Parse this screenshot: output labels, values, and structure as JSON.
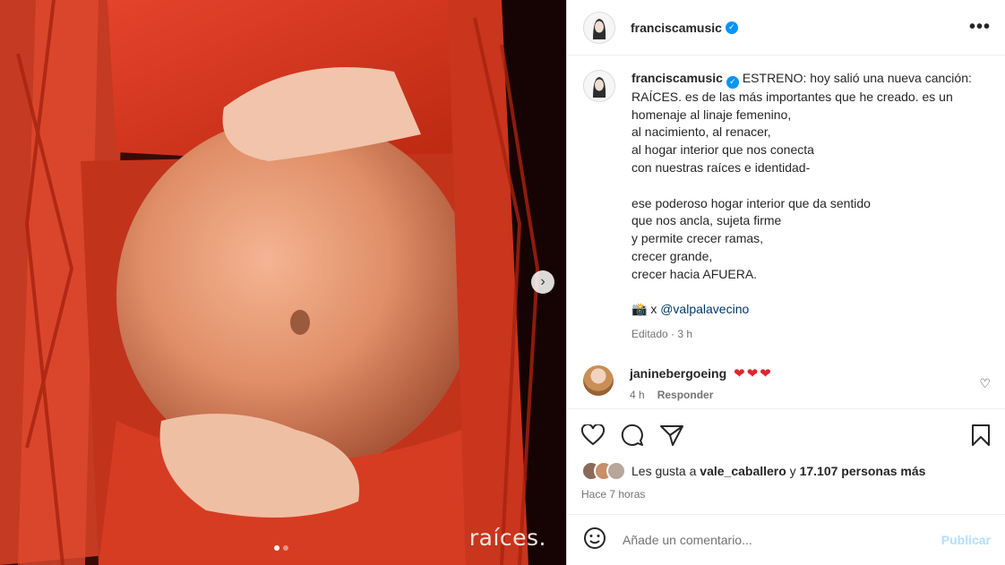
{
  "media": {
    "overlay_text": "raíces.",
    "slide_count": 2,
    "current_slide": 1,
    "next_glyph": "›"
  },
  "header": {
    "username": "franciscamusic",
    "verified_glyph": "✓",
    "more_glyph": "•••"
  },
  "post": {
    "username": "franciscamusic",
    "caption_lines": [
      " ESTRENO: hoy salió una nueva canción:",
      "RAÍCES. es de las más importantes que he creado. es un",
      "homenaje al linaje femenino,",
      "al nacimiento, al renacer,",
      "al hogar interior que nos conecta",
      "con nuestras raíces e identidad-",
      "",
      "ese poderoso hogar interior que da sentido",
      "que nos ancla, sujeta firme",
      "y permite crecer ramas,",
      "crecer grande,",
      "crecer hacia AFUERA.",
      ""
    ],
    "credit_emoji": "📸",
    "credit_prefix": " x ",
    "credit_mention": "@valpalavecino",
    "edited_label": "Editado · 3 h"
  },
  "comment": {
    "username": "janinebergoeing",
    "text": "❤❤❤",
    "age": "4 h",
    "reply_label": "Responder",
    "like_glyph": "♡"
  },
  "likes": {
    "prefix": "Les gusta a ",
    "user": "vale_caballero",
    "middle": " y ",
    "count": "17.107 personas más"
  },
  "posted_time": "Hace 7 horas",
  "add_comment": {
    "emoji_glyph": "☺",
    "placeholder": "Añade un comentario...",
    "publish_label": "Publicar"
  },
  "colors": {
    "accent": "#0095f6",
    "publish_disabled": "#b2dffc",
    "heart": "#e3252c",
    "dress_red": "#d9331f"
  }
}
